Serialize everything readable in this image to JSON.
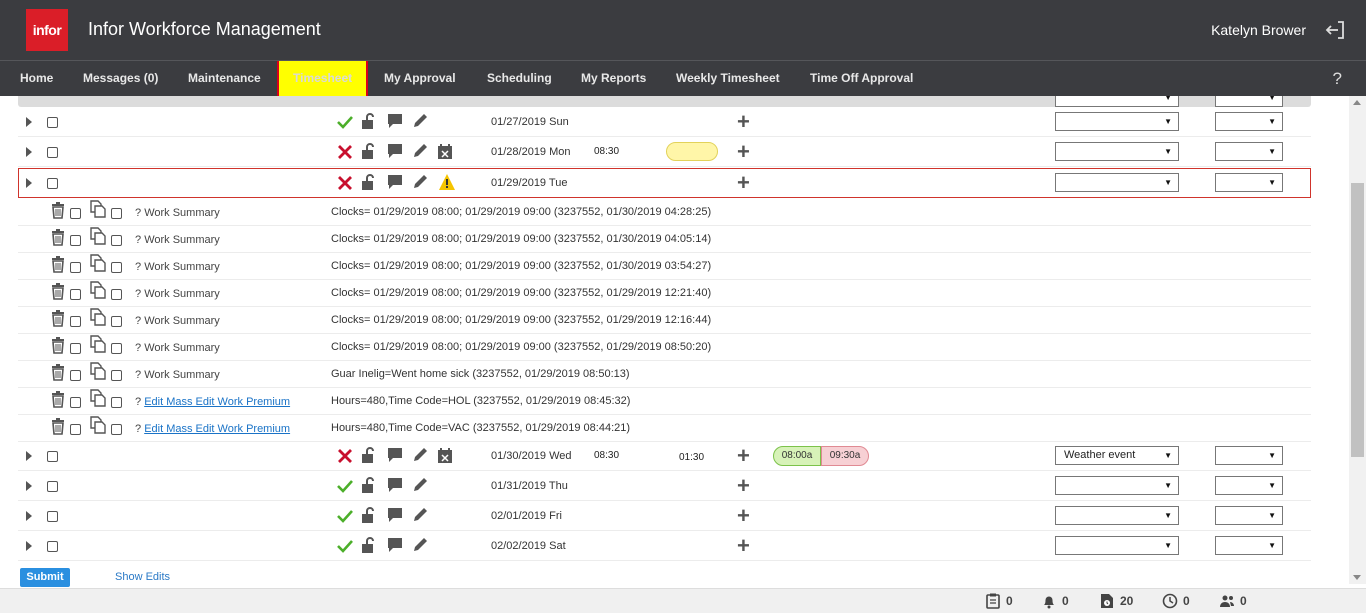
{
  "header": {
    "logo_text": "infor",
    "app_title": "Infor Workforce Management",
    "user_name": "Katelyn Brower",
    "help": "?"
  },
  "nav": [
    {
      "label": "Home"
    },
    {
      "label": "Messages (0)"
    },
    {
      "label": "Maintenance"
    },
    {
      "label": "Timesheet",
      "active": true
    },
    {
      "label": "My Approval"
    },
    {
      "label": "Scheduling"
    },
    {
      "label": "My Reports"
    },
    {
      "label": "Weekly Timesheet"
    },
    {
      "label": "Time Off Approval"
    }
  ],
  "days": [
    {
      "date": "01/27/2019 Sun",
      "status": "ok",
      "in": "",
      "out_total": "",
      "shift_in": "",
      "shift_out": "",
      "reason": "",
      "extra": ""
    },
    {
      "date": "01/28/2019 Mon",
      "status": "error",
      "in": "08:30",
      "out_total": "",
      "shift_in": "",
      "shift_out": "",
      "reason": "",
      "extra": ""
    },
    {
      "date": "01/29/2019 Tue",
      "status": "error",
      "warning": true,
      "in": "",
      "out_total": "",
      "reason": "",
      "extra": ""
    },
    {
      "date": "01/30/2019 Wed",
      "status": "error",
      "in": "08:30",
      "out_total": "01:30",
      "shift_in": "08:00a",
      "shift_out": "09:30a",
      "reason": "Weather event",
      "extra": ""
    },
    {
      "date": "01/31/2019 Thu",
      "status": "ok",
      "reason": "",
      "extra": ""
    },
    {
      "date": "02/01/2019 Fri",
      "status": "ok",
      "reason": "",
      "extra": ""
    },
    {
      "date": "02/02/2019 Sat",
      "status": "ok",
      "reason": "",
      "extra": ""
    }
  ],
  "work_summaries": [
    {
      "prefix": "?",
      "label": "Work Summary",
      "link": false,
      "detail": "Clocks= 01/29/2019 08:00; 01/29/2019 09:00 (3237552, 01/30/2019 04:28:25)"
    },
    {
      "prefix": "?",
      "label": "Work Summary",
      "link": false,
      "detail": "Clocks= 01/29/2019 08:00; 01/29/2019 09:00 (3237552, 01/30/2019 04:05:14)"
    },
    {
      "prefix": "?",
      "label": "Work Summary",
      "link": false,
      "detail": "Clocks= 01/29/2019 08:00; 01/29/2019 09:00 (3237552, 01/30/2019 03:54:27)"
    },
    {
      "prefix": "?",
      "label": "Work Summary",
      "link": false,
      "detail": "Clocks= 01/29/2019 08:00; 01/29/2019 09:00 (3237552, 01/29/2019 12:21:40)"
    },
    {
      "prefix": "?",
      "label": "Work Summary",
      "link": false,
      "detail": "Clocks= 01/29/2019 08:00; 01/29/2019 09:00 (3237552, 01/29/2019 12:16:44)"
    },
    {
      "prefix": "?",
      "label": "Work Summary",
      "link": false,
      "detail": "Clocks= 01/29/2019 08:00; 01/29/2019 09:00 (3237552, 01/29/2019 08:50:20)"
    },
    {
      "prefix": "?",
      "label": "Work Summary",
      "link": false,
      "detail": "Guar Inelig=Went home sick (3237552, 01/29/2019 08:50:13)"
    },
    {
      "prefix": "?",
      "label": "Edit Mass Edit Work Premium",
      "link": true,
      "detail": "Hours=480,Time Code=HOL (3237552, 01/29/2019 08:45:32)"
    },
    {
      "prefix": "?",
      "label": "Edit Mass Edit Work Premium",
      "link": true,
      "detail": "Hours=480,Time Code=VAC (3237552, 01/29/2019 08:44:21)"
    }
  ],
  "actions": {
    "submit": "Submit",
    "show_edits": "Show Edits"
  },
  "status_bar": [
    {
      "icon": "clipboard-icon",
      "count": "0"
    },
    {
      "icon": "bell-icon",
      "count": "0"
    },
    {
      "icon": "document-clock-icon",
      "count": "20"
    },
    {
      "icon": "clock-icon",
      "count": "0"
    },
    {
      "icon": "people-icon",
      "count": "0"
    }
  ],
  "colors": {
    "header_bg": "#3b3c40",
    "active_tab": "#ffff00",
    "brand_red": "#da1e28",
    "submit_blue": "#2a8fe0",
    "ok_green": "#4caf2a",
    "error_red": "#c8102e",
    "warning_yellow": "#f5c400"
  }
}
